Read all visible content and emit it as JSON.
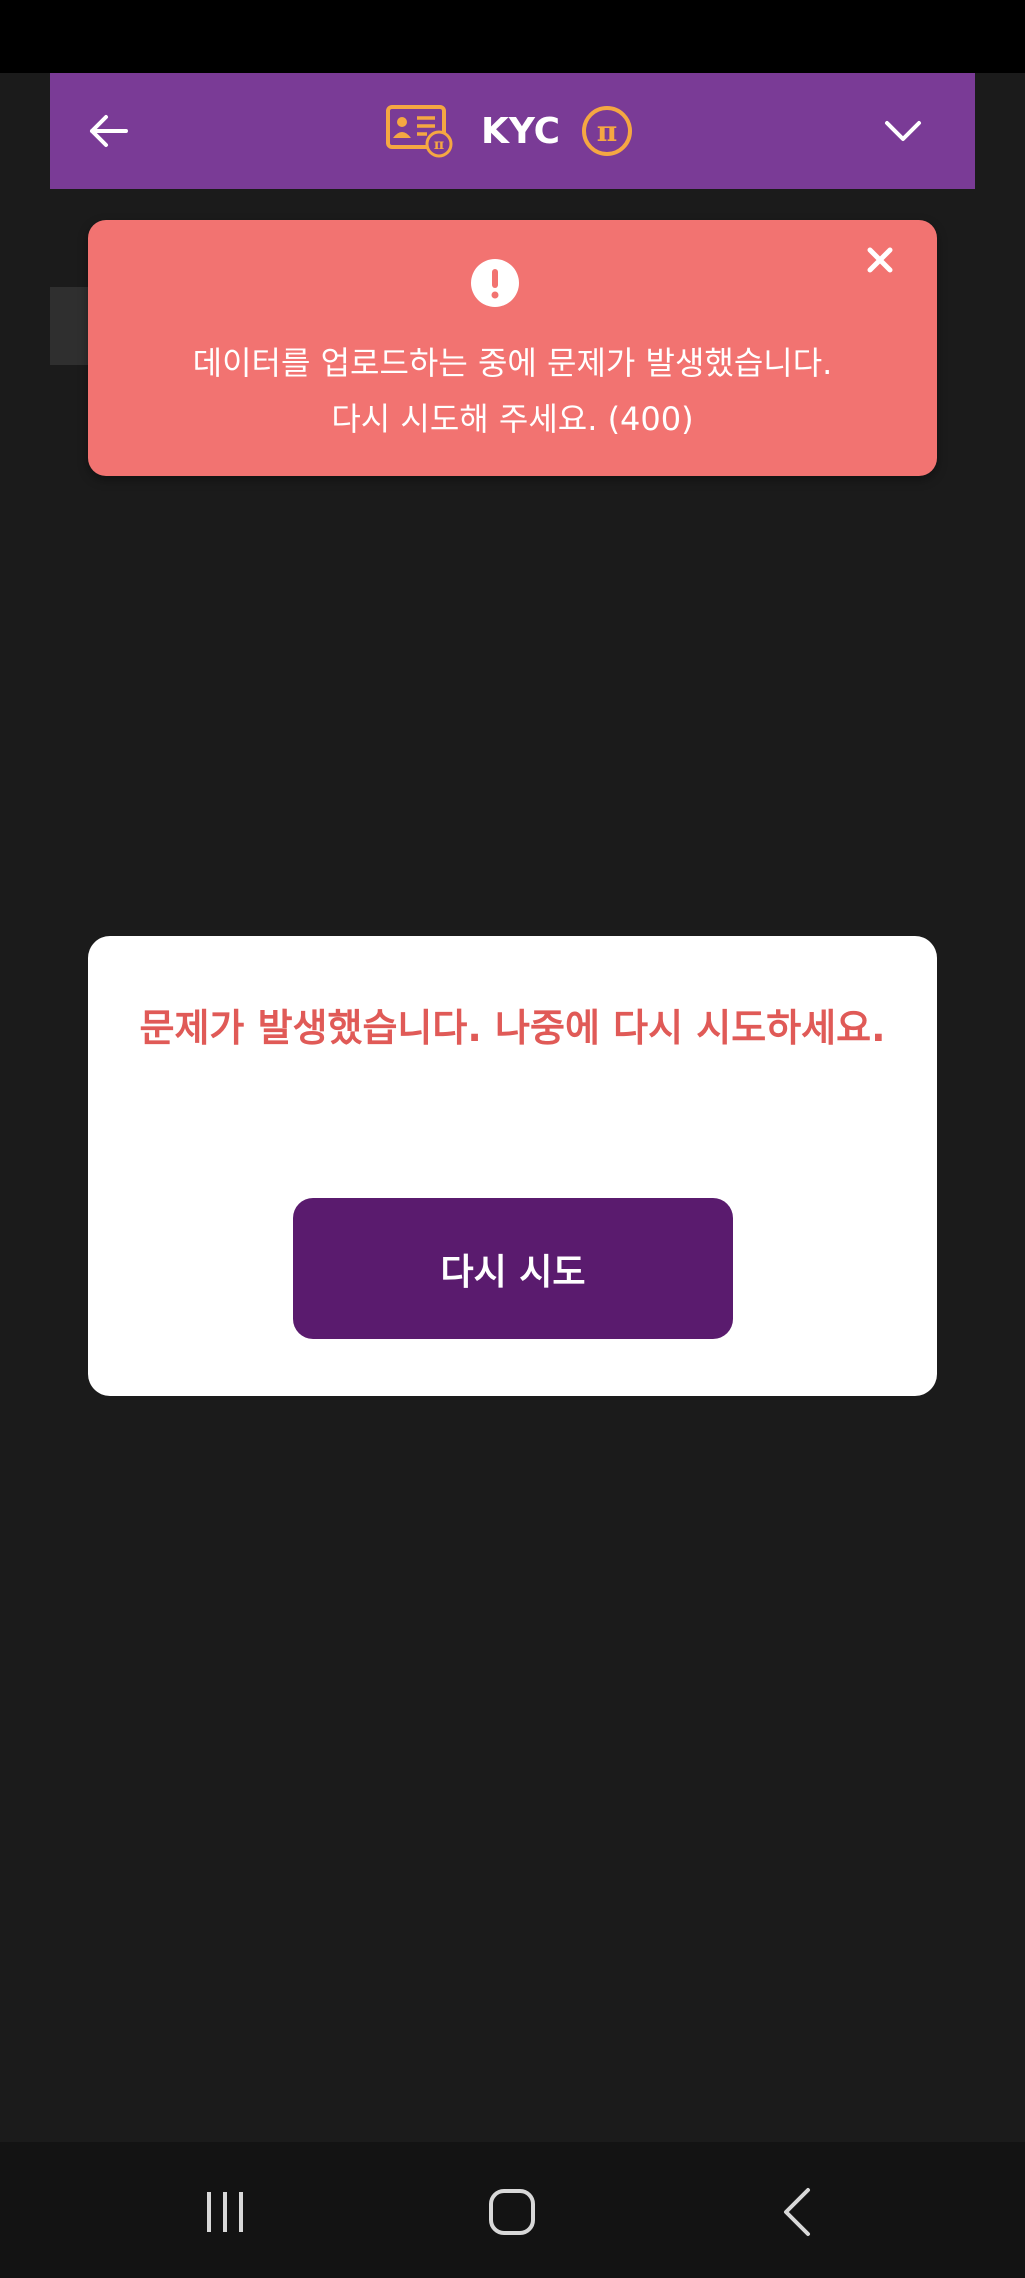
{
  "header": {
    "title": "KYC",
    "back_icon": "arrow-left-icon",
    "id_card_icon": "id-card-icon",
    "pi_coin_icon": "pi-coin-icon",
    "menu_icon": "chevron-down-icon",
    "background_color": "#7a3b96",
    "accent_color": "#f5a742"
  },
  "toast": {
    "icon": "exclamation-icon",
    "close_icon": "close-icon",
    "line1": "데이터를 업로드하는 중에 문제가 발생했습니다.",
    "line2": "다시 시도해 주세요. (400)",
    "background_color": "#f27371"
  },
  "dialog": {
    "message": "문제가 발생했습니다. 나중에 다시 시도하세요.",
    "retry_label": "다시 시도",
    "message_color": "#e05a57",
    "button_color": "#5a1b6e"
  },
  "nav_bar": {
    "recent_icon": "recent-apps-icon",
    "home_icon": "home-icon",
    "back_icon": "back-chevron-icon"
  }
}
